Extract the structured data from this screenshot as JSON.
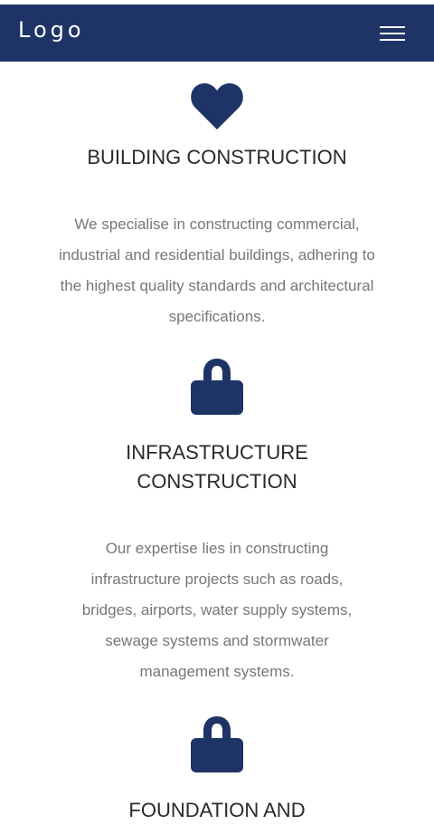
{
  "header": {
    "logo_text": "Logo",
    "menu_icon": "hamburger-menu-icon",
    "background_color": "#1e3466"
  },
  "services": [
    {
      "icon": "heart-icon",
      "title": "BUILDING CONSTRUCTION",
      "description": "We specialise in constructing commercial, industrial and residential buildings, adhering to the highest quality standards and architectural specifications."
    },
    {
      "icon": "lock-icon",
      "title": "INFRASTRUCTURE CONSTRUCTION",
      "description": "Our expertise lies in constructing infrastructure projects such as roads, bridges, airports, water supply systems, sewage systems and stormwater management systems."
    },
    {
      "icon": "lock-icon",
      "title": "FOUNDATION AND"
    }
  ],
  "accent_color": "#1e3466"
}
